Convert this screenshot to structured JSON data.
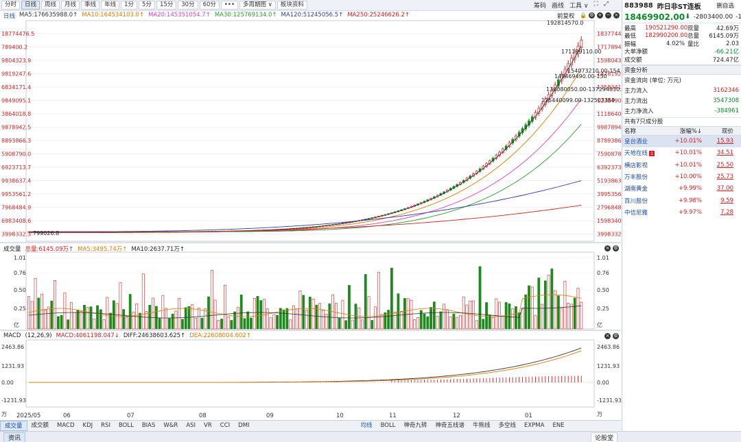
{
  "toolbar": {
    "buttons": [
      "分时",
      "日线",
      "周线",
      "月线",
      "季线",
      "年线",
      "1分",
      "5分",
      "15分",
      "30分",
      "60分",
      "•••",
      "多周期图 ∨",
      "板块资料"
    ],
    "active_index": 1,
    "right": [
      "筹码",
      "画线",
      "工具 ∨"
    ]
  },
  "legend_main": {
    "label": "日线",
    "ma5": "MA5:176635988.0↑",
    "ma10": "MA10:164534103.0↑",
    "ma20": "MA20:145351054.7↑",
    "ma30": "MA30:125769134.0↑",
    "ma120": "MA120:51245056.5↑",
    "ma250": "MA250:25246626.2↑",
    "adjust": "前复权"
  },
  "colors": {
    "ma5": "#333333",
    "ma10": "#e07b00",
    "ma20": "#e040b8",
    "ma30": "#2e9b2e",
    "ma120": "#2a3f9c",
    "ma250": "#d02020",
    "up": "#d81e1e",
    "down": "#1e8a1e"
  },
  "price_axis_left": [
    "18774476.5",
    "789400.2",
    "9804323.9",
    "9819247.6",
    "6834171.4",
    "9849095.1",
    "3864018.8",
    "9878942.5",
    "8893866.3",
    "5908790.0",
    "6923713.7",
    "9938637.4",
    "9953561.2",
    "7968484.9",
    "6983408.6",
    "3998332.3"
  ],
  "price_axis_right": [
    "18377447",
    "17178940",
    "15980432",
    "14781924",
    "13583417",
    "12384909",
    "11186401",
    "9987894",
    "8789386",
    "7590878",
    "6392373",
    "5193863",
    "3995356",
    "2796848",
    "1598340",
    "3998332"
  ],
  "annotations": {
    "high": "192814570.0",
    "low": "799026.8",
    "a1": "171199110.00",
    "a2": "154073210.00-154",
    "a3": "149469490.00-150",
    "a4": "136080050.00-137294830.",
    "a5": "125440099.00-132503359"
  },
  "volume": {
    "label": "成交量",
    "total": "总量:6145.09万↑",
    "ma5": "MA5:3495.74万↑",
    "ma10": "MA10:2637.71万↑",
    "axis": [
      "1.01",
      "0.76",
      "0.50",
      "0.25",
      "亿"
    ]
  },
  "macd": {
    "label": "MACD",
    "params": "(12,26,9)",
    "macd": "MACD:4061198.047↓",
    "diff": "DIFF:24638603.625↑",
    "dea": "DEA:22608004.602↑",
    "axis": [
      "2463.86",
      "1231.93",
      "0.00",
      "-1231.93",
      "万"
    ]
  },
  "x_axis": [
    "2025/05",
    "06",
    "07",
    "08",
    "09",
    "10",
    "11",
    "12",
    "01"
  ],
  "bottom_tabs_left": [
    "成交量",
    "成交额",
    "MACD",
    "KDJ",
    "RSI",
    "BOLL",
    "BIAS",
    "W&R",
    "ASI",
    "VR",
    "CCI",
    "DMI"
  ],
  "bottom_tabs_right": [
    "均线",
    "BOLL",
    "神奇九转",
    "神奇五线谱",
    "牛熊线",
    "多空线",
    "EXPMA",
    "ENE"
  ],
  "info_bar": {
    "left": "资讯",
    "right": "论股堂"
  },
  "quote": {
    "code": "883988",
    "name": "昨日非ST连板",
    "action": "删自选",
    "price": "18469902.00",
    "price_arrow": "⬇",
    "change": "-2803400.00",
    "change_pct": "-1",
    "stats": [
      {
        "k": "最高",
        "v": "190521290.00",
        "k2": "现量",
        "v2": "42.69万"
      },
      {
        "k": "最低",
        "v": "182990200.00",
        "k2": "总量",
        "v2": "6145.09万"
      },
      {
        "k": "振幅",
        "v": "4.02%",
        "k2": "量比",
        "v2": "2.03"
      },
      {
        "k": "大单净额",
        "v": "",
        "k2": "",
        "v2": "-66.21亿"
      },
      {
        "k": "成交额",
        "v": "",
        "k2": "",
        "v2": "724.47亿"
      }
    ]
  },
  "fund": {
    "title": "资金分析",
    "unit": "资金流向 (单位: 万元)",
    "rows": [
      {
        "k": "主力流入",
        "v": "3162346"
      },
      {
        "k": "主力流出",
        "v": "3547308"
      },
      {
        "k": "主力净流入",
        "v": "-384961"
      }
    ]
  },
  "components": {
    "title": "共有7只成分股",
    "headers": [
      "名称",
      "涨幅%↓",
      "现价"
    ],
    "rows": [
      {
        "name": "皇台酒业",
        "chg": "+10.01%",
        "price": "15.93",
        "badge": ""
      },
      {
        "name": "天地在线",
        "chg": "+10.01%",
        "price": "34.51",
        "badge": "1"
      },
      {
        "name": "横店影视",
        "chg": "+10.01%",
        "price": "25.50",
        "badge": ""
      },
      {
        "name": "万丰股份",
        "chg": "+10.00%",
        "price": "25.73",
        "badge": ""
      },
      {
        "name": "湖南黄金",
        "chg": "+9.99%",
        "price": "37.00",
        "badge": ""
      },
      {
        "name": "百川股份",
        "chg": "+9.98%",
        "price": "9.59",
        "badge": ""
      },
      {
        "name": "中信尼雅",
        "chg": "+9.97%",
        "price": "7.28",
        "badge": ""
      }
    ]
  }
}
